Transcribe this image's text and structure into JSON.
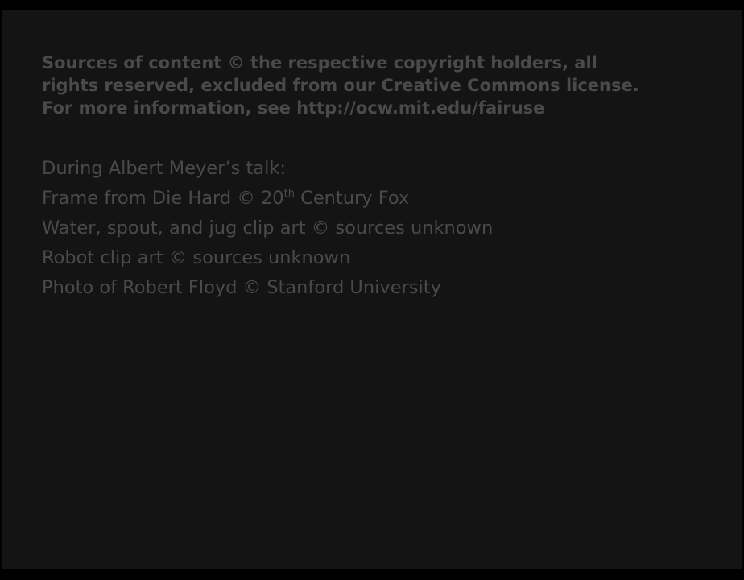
{
  "notice": {
    "line1": "Sources of content © the respective copyright holders, all",
    "line2": "rights reserved, excluded from our Creative Commons license.",
    "line3": "For more information, see http://ocw.mit.edu/fairuse"
  },
  "credits": {
    "heading": "During Albert Meyer’s talk:",
    "die_hard_prefix": "Frame from Die Hard © 20",
    "die_hard_superscript": "th",
    "die_hard_suffix": " Century Fox",
    "water_jug": "Water, spout, and jug clip art © sources unknown",
    "robot": "Robot clip art © sources unknown",
    "floyd": "Photo of Robert Floyd © Stanford University"
  },
  "colors": {
    "background": "#141414",
    "text": "#4a4a4a"
  }
}
